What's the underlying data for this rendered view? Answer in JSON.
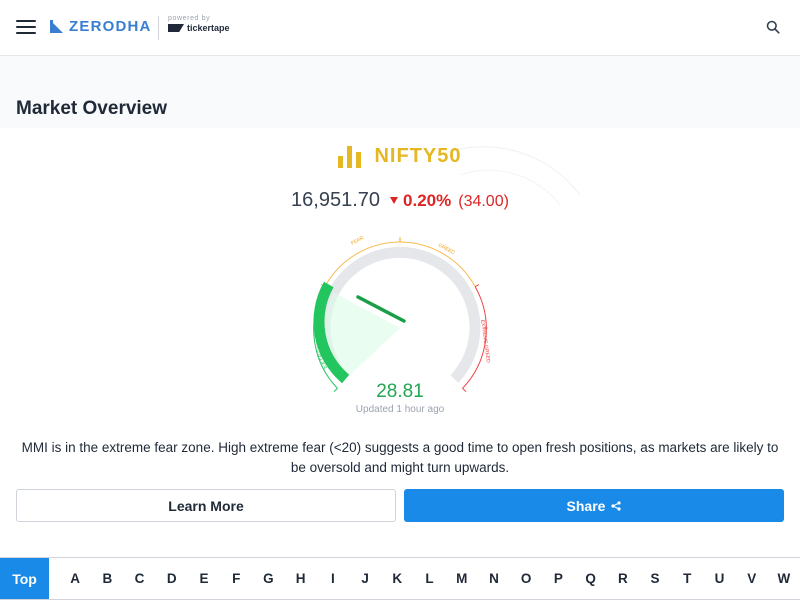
{
  "header": {
    "brand": "ZERODHA",
    "powered_by": "powered by",
    "partner": "tickertape"
  },
  "page_title": "Market Overview",
  "index": {
    "name": "NIFTY50",
    "price": "16,951.70",
    "change_pct": "0.20%",
    "change_abs": "(34.00)"
  },
  "gauge": {
    "labels": [
      "EXTREME FEAR",
      "FEAR",
      "GREED",
      "EXTREME GREED"
    ],
    "value": "28.81",
    "level": 28.81,
    "updated": "Updated 1 hour ago"
  },
  "description": "MMI is in the extreme fear zone. High extreme fear (<20) suggests a good time to open fresh positions, as markets are likely to be oversold and might turn upwards.",
  "buttons": {
    "learn_more": "Learn More",
    "share": "Share"
  },
  "az_nav": {
    "top": "Top",
    "letters": [
      "A",
      "B",
      "C",
      "D",
      "E",
      "F",
      "G",
      "H",
      "I",
      "J",
      "K",
      "L",
      "M",
      "N",
      "O",
      "P",
      "Q",
      "R",
      "S",
      "T",
      "U",
      "V",
      "W"
    ]
  },
  "colors": {
    "brand": "#387ed1",
    "index": "#e5b722",
    "negative": "#dc2626",
    "fear": "#22c55e",
    "accent": "#1a8ae8"
  }
}
